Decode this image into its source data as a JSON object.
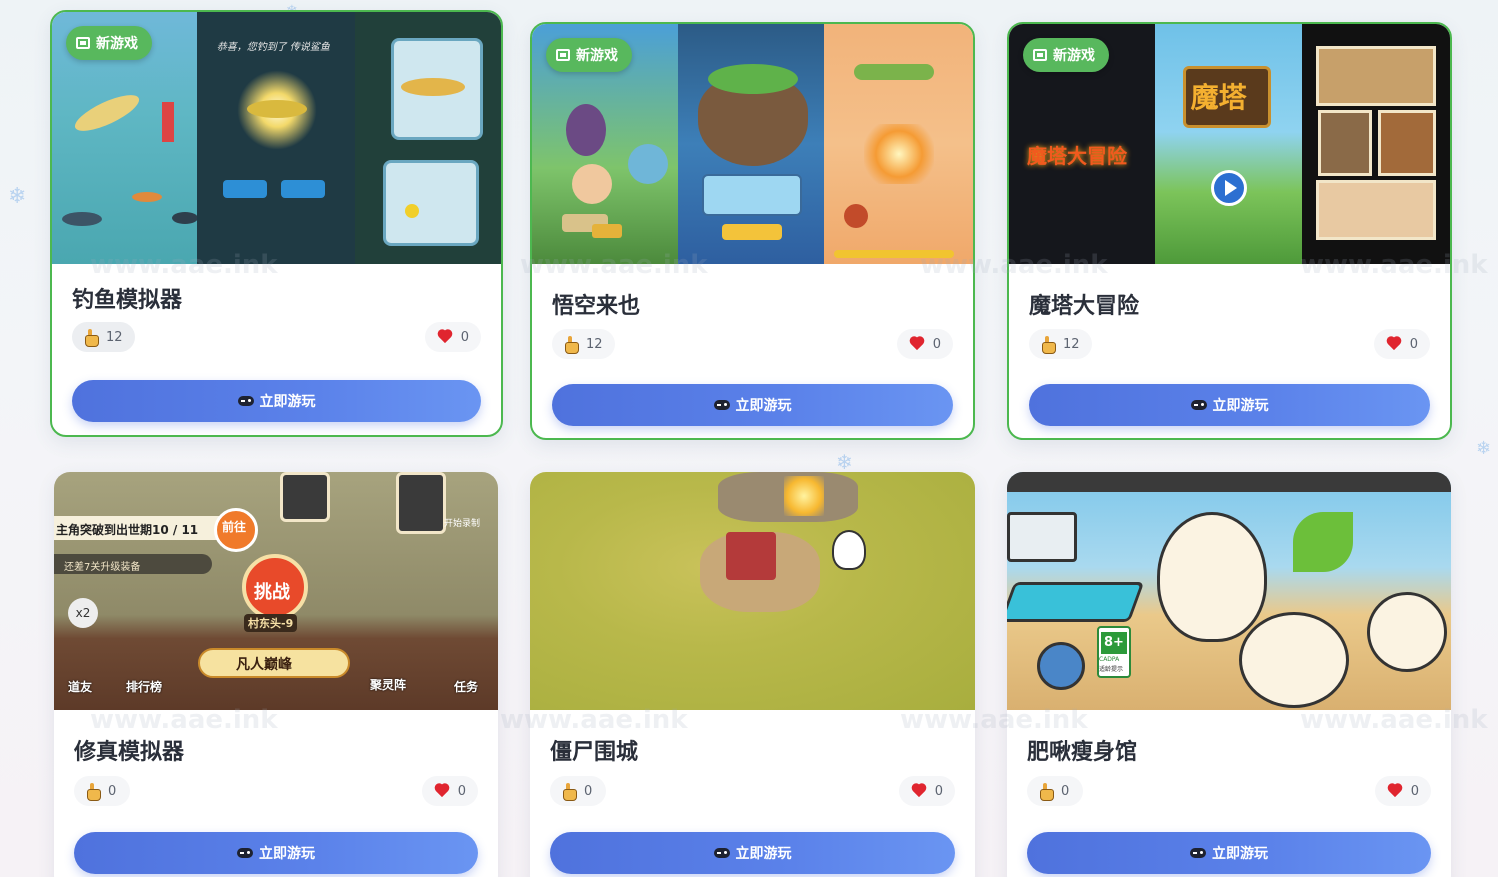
{
  "watermark": "www.aae.ink",
  "colors": {
    "new_border": "#4cb84f",
    "new_badge": "#58b85d",
    "button_start": "#4f72dd",
    "button_end": "#6a95f2",
    "heart": "#e0252f"
  },
  "cards": [
    {
      "title": "钓鱼模拟器",
      "badge": "新游戏",
      "plays": "12",
      "likes": "0",
      "button": "立即游玩",
      "icons": {
        "play": "pointer-hand-icon",
        "like": "heart-icon",
        "button": "gamepad-icon"
      }
    },
    {
      "title": "悟空来也",
      "badge": "新游戏",
      "plays": "12",
      "likes": "0",
      "button": "立即游玩"
    },
    {
      "title": "魔塔大冒险",
      "badge": "新游戏",
      "plays": "12",
      "likes": "0",
      "button": "立即游玩"
    },
    {
      "title": "修真模拟器",
      "plays": "0",
      "likes": "0",
      "button": "立即游玩"
    },
    {
      "title": "僵尸围城",
      "plays": "0",
      "likes": "0",
      "button": "立即游玩"
    },
    {
      "title": "肥啾瘦身馆",
      "plays": "0",
      "likes": "0",
      "button": "立即游玩"
    }
  ],
  "thumb_text": {
    "fishing_caption": "恭喜，您钓到了 传说鲨鱼",
    "mota_logo": "魔塔",
    "mota_logo2": "魔塔大冒险",
    "xiuzhen_quest": "主角突破到出世期10 / 11",
    "xiuzhen_hint": "还差7关升级装备",
    "xiuzhen_challenge": "挑战",
    "xiuzhen_stage": "村东头-9",
    "xiuzhen_realm": "凡人巅峰",
    "xiuzhen_goto": "前往",
    "xiuzhen_record": "开始录制",
    "xiuzhen_x2": "x2",
    "xiuzhen_menu": [
      "道友",
      "排行榜",
      "聚灵阵",
      "任务"
    ],
    "rating": "8+",
    "rating_org": "CADPA",
    "rating_sub": "适龄提示"
  }
}
